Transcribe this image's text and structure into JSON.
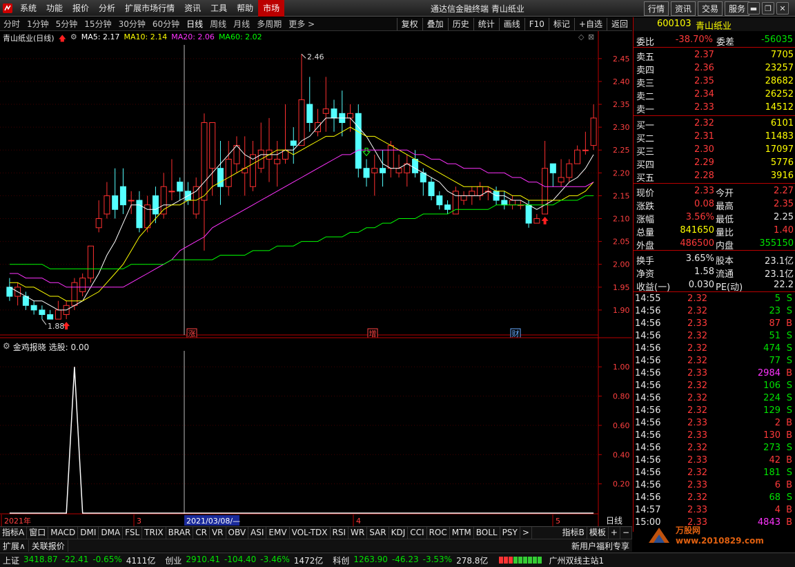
{
  "menubar": {
    "items": [
      "系统",
      "功能",
      "报价",
      "分析",
      "扩展市场行情",
      "资讯",
      "工具",
      "帮助"
    ],
    "active_item": "市场",
    "title": "通达信金融终端  青山纸业",
    "right_buttons": [
      "行情",
      "资讯",
      "交易",
      "服务"
    ]
  },
  "toolbar": {
    "periods": [
      "分时",
      "1分钟",
      "5分钟",
      "15分钟",
      "30分钟",
      "60分钟",
      "日线",
      "周线",
      "月线",
      "多周期",
      "更多 >"
    ],
    "active_period": "日线",
    "tools": [
      "复权",
      "叠加",
      "历史",
      "统计",
      "画线",
      "F10",
      "标记",
      "+自选",
      "返回"
    ]
  },
  "chart_legend": {
    "title": "青山纸业(日线)",
    "ma": [
      {
        "label": "MA5: 2.17",
        "color": "#ffffff"
      },
      {
        "label": "MA10: 2.14",
        "color": "#ffff00"
      },
      {
        "label": "MA20: 2.06",
        "color": "#ff33ff"
      },
      {
        "label": "MA60: 2.02",
        "color": "#00ff00"
      }
    ]
  },
  "chart_data": [
    {
      "type": "candlestick",
      "title": "青山纸业(日线)",
      "y_axis": {
        "min": 1.85,
        "max": 2.48,
        "ticks": [
          "2.45",
          "2.40",
          "2.35",
          "2.30",
          "2.25",
          "2.20",
          "2.15",
          "2.10",
          "2.05",
          "2.00",
          "1.95",
          "1.90"
        ]
      },
      "x_labels": [
        "2021年",
        "3",
        "4",
        "5"
      ],
      "cursor_date": "2021/03/08/—",
      "high_annotation": "2.46",
      "low_annotation": "1.88",
      "candles": [
        [
          1.95,
          1.93,
          1.97,
          1.92
        ],
        [
          1.93,
          1.95,
          1.96,
          1.91
        ],
        [
          1.93,
          1.91,
          1.94,
          1.9
        ],
        [
          1.91,
          1.9,
          1.92,
          1.89
        ],
        [
          1.9,
          1.89,
          1.91,
          1.88
        ],
        [
          1.89,
          1.88,
          1.9,
          1.88
        ],
        [
          1.88,
          1.9,
          1.92,
          1.88
        ],
        [
          1.89,
          1.91,
          1.92,
          1.88
        ],
        [
          1.91,
          1.96,
          1.97,
          1.9
        ],
        [
          1.94,
          1.97,
          1.98,
          1.93
        ],
        [
          1.97,
          2.04,
          2.04,
          1.96
        ],
        [
          2.08,
          2.1,
          2.14,
          2.07
        ],
        [
          2.11,
          2.15,
          2.18,
          2.1
        ],
        [
          2.15,
          2.12,
          2.21,
          2.1
        ],
        [
          2.17,
          2.13,
          2.21,
          2.11
        ],
        [
          2.14,
          2.14,
          2.16,
          2.11
        ],
        [
          2.14,
          2.08,
          2.16,
          2.07
        ],
        [
          2.08,
          2.13,
          2.15,
          2.07
        ],
        [
          2.15,
          2.11,
          2.17,
          2.09
        ],
        [
          2.11,
          2.17,
          2.2,
          2.1
        ],
        [
          2.16,
          2.16,
          2.23,
          2.14
        ],
        [
          2.18,
          2.16,
          2.19,
          2.14
        ],
        [
          2.16,
          2.14,
          2.18,
          2.13
        ],
        [
          2.11,
          2.17,
          2.19,
          2.1
        ],
        [
          2.14,
          2.31,
          2.33,
          2.03
        ],
        [
          2.21,
          2.31,
          2.31,
          2.15
        ],
        [
          2.21,
          2.17,
          2.27,
          2.13
        ],
        [
          2.17,
          2.23,
          2.27,
          2.15
        ],
        [
          2.22,
          2.26,
          2.28,
          2.2
        ],
        [
          2.2,
          2.21,
          2.28,
          2.15
        ],
        [
          2.17,
          2.24,
          2.27,
          2.16
        ],
        [
          2.21,
          2.25,
          2.31,
          2.2
        ],
        [
          2.23,
          2.25,
          2.32,
          2.18
        ],
        [
          2.22,
          2.23,
          2.27,
          2.17
        ],
        [
          2.23,
          2.25,
          2.35,
          2.22
        ],
        [
          2.27,
          2.26,
          2.3,
          2.22
        ],
        [
          2.26,
          2.36,
          2.46,
          2.26
        ],
        [
          2.35,
          2.31,
          2.41,
          2.29
        ],
        [
          2.29,
          2.31,
          2.34,
          2.28
        ],
        [
          2.33,
          2.34,
          2.41,
          2.29
        ],
        [
          2.34,
          2.32,
          2.36,
          2.29
        ],
        [
          2.33,
          2.31,
          2.38,
          2.28
        ],
        [
          2.32,
          2.33,
          2.35,
          2.29
        ],
        [
          2.33,
          2.21,
          2.35,
          2.19
        ],
        [
          2.21,
          2.19,
          2.23,
          2.17
        ],
        [
          2.2,
          2.21,
          2.24,
          2.15
        ],
        [
          2.21,
          2.2,
          2.25,
          2.17
        ],
        [
          2.21,
          2.26,
          2.27,
          2.19
        ],
        [
          2.2,
          2.21,
          2.24,
          2.19
        ],
        [
          2.2,
          2.22,
          2.24,
          2.17
        ],
        [
          2.23,
          2.2,
          2.25,
          2.19
        ],
        [
          2.2,
          2.18,
          2.21,
          2.15
        ],
        [
          2.18,
          2.15,
          2.19,
          2.14
        ],
        [
          2.15,
          2.13,
          2.16,
          2.12
        ],
        [
          2.13,
          2.12,
          2.14,
          2.11
        ],
        [
          2.11,
          2.16,
          2.17,
          2.11
        ],
        [
          2.14,
          2.15,
          2.16,
          2.13
        ],
        [
          2.15,
          2.16,
          2.17,
          2.13
        ],
        [
          2.15,
          2.17,
          2.18,
          2.14
        ],
        [
          2.16,
          2.16,
          2.17,
          2.14
        ],
        [
          2.16,
          2.14,
          2.17,
          2.13
        ],
        [
          2.14,
          2.13,
          2.16,
          2.12
        ],
        [
          2.13,
          2.14,
          2.15,
          2.12
        ],
        [
          2.13,
          2.13,
          2.14,
          2.12
        ],
        [
          2.13,
          2.09,
          2.14,
          2.08
        ],
        [
          2.09,
          2.1,
          2.11,
          2.09
        ],
        [
          2.11,
          2.21,
          2.27,
          2.11
        ],
        [
          2.22,
          2.2,
          2.22,
          2.17
        ],
        [
          2.18,
          2.19,
          2.23,
          2.17
        ],
        [
          2.19,
          2.22,
          2.23,
          2.18
        ],
        [
          2.22,
          2.25,
          2.26,
          2.22
        ],
        [
          2.25,
          2.25,
          2.29,
          2.24
        ],
        [
          2.26,
          2.32,
          2.35,
          2.25
        ]
      ],
      "series": [
        {
          "name": "MA5",
          "color": "#ffffff",
          "values": [
            1.95,
            1.94,
            1.93,
            1.92,
            1.92,
            1.91,
            1.9,
            1.9,
            1.91,
            1.92,
            1.95,
            1.98,
            2.02,
            2.05,
            2.09,
            2.13,
            2.13,
            2.12,
            2.12,
            2.13,
            2.13,
            2.14,
            2.15,
            2.16,
            2.18,
            2.2,
            2.22,
            2.24,
            2.26,
            2.24,
            2.23,
            2.24,
            2.24,
            2.24,
            2.25,
            2.25,
            2.27,
            2.28,
            2.3,
            2.32,
            2.32,
            2.32,
            2.32,
            2.3,
            2.28,
            2.25,
            2.22,
            2.21,
            2.21,
            2.22,
            2.21,
            2.2,
            2.19,
            2.18,
            2.16,
            2.15,
            2.15,
            2.15,
            2.15,
            2.16,
            2.15,
            2.15,
            2.14,
            2.14,
            2.13,
            2.12,
            2.13,
            2.14,
            2.16,
            2.18,
            2.19,
            2.21,
            2.24
          ]
        },
        {
          "name": "MA10",
          "color": "#ffff00",
          "values": [
            1.96,
            1.96,
            1.95,
            1.95,
            1.94,
            1.93,
            1.93,
            1.92,
            1.92,
            1.92,
            1.93,
            1.94,
            1.96,
            1.98,
            2.0,
            2.03,
            2.06,
            2.08,
            2.1,
            2.12,
            2.13,
            2.13,
            2.14,
            2.14,
            2.15,
            2.17,
            2.18,
            2.19,
            2.2,
            2.21,
            2.22,
            2.23,
            2.24,
            2.25,
            2.25,
            2.24,
            2.25,
            2.26,
            2.27,
            2.28,
            2.28,
            2.29,
            2.3,
            2.29,
            2.28,
            2.28,
            2.27,
            2.26,
            2.25,
            2.24,
            2.23,
            2.22,
            2.21,
            2.2,
            2.19,
            2.18,
            2.17,
            2.17,
            2.17,
            2.17,
            2.16,
            2.16,
            2.15,
            2.15,
            2.14,
            2.14,
            2.14,
            2.14,
            2.14,
            2.15,
            2.15,
            2.16,
            2.18
          ]
        },
        {
          "name": "MA20",
          "color": "#ff33ff",
          "values": [
            1.98,
            1.98,
            1.97,
            1.97,
            1.97,
            1.96,
            1.96,
            1.95,
            1.95,
            1.95,
            1.95,
            1.95,
            1.95,
            1.95,
            1.95,
            1.96,
            1.97,
            1.98,
            1.99,
            2.0,
            2.01,
            2.03,
            2.04,
            2.05,
            2.06,
            2.08,
            2.09,
            2.1,
            2.11,
            2.12,
            2.13,
            2.14,
            2.15,
            2.16,
            2.17,
            2.18,
            2.19,
            2.2,
            2.21,
            2.22,
            2.23,
            2.24,
            2.24,
            2.25,
            2.25,
            2.25,
            2.25,
            2.25,
            2.25,
            2.25,
            2.24,
            2.24,
            2.23,
            2.23,
            2.22,
            2.22,
            2.21,
            2.21,
            2.21,
            2.2,
            2.2,
            2.2,
            2.19,
            2.19,
            2.18,
            2.18,
            2.17,
            2.17,
            2.17,
            2.17,
            2.17,
            2.17,
            2.18
          ]
        },
        {
          "name": "MA60",
          "color": "#00ff00",
          "values": [
            2.0,
            2.0,
            2.0,
            2.0,
            2.0,
            1.99,
            1.99,
            1.99,
            1.99,
            1.99,
            1.99,
            1.99,
            1.99,
            1.99,
            1.99,
            2.0,
            2.0,
            2.0,
            2.0,
            2.0,
            2.01,
            2.01,
            2.01,
            2.01,
            2.01,
            2.01,
            2.02,
            2.02,
            2.02,
            2.02,
            2.03,
            2.03,
            2.03,
            2.04,
            2.04,
            2.04,
            2.05,
            2.05,
            2.05,
            2.06,
            2.06,
            2.06,
            2.07,
            2.07,
            2.08,
            2.08,
            2.09,
            2.09,
            2.1,
            2.1,
            2.1,
            2.11,
            2.11,
            2.11,
            2.11,
            2.12,
            2.12,
            2.12,
            2.12,
            2.12,
            2.13,
            2.13,
            2.13,
            2.13,
            2.13,
            2.13,
            2.13,
            2.13,
            2.14,
            2.14,
            2.14,
            2.15,
            2.15
          ]
        }
      ],
      "markers": [
        {
          "label": "涨",
          "color": "#ff4444"
        },
        {
          "label": "增",
          "color": "#ff4444"
        },
        {
          "label": "财",
          "color": "#66aaff"
        }
      ]
    },
    {
      "type": "line",
      "title": "金鸡报晓 选股: 0.00",
      "y_axis": {
        "min": 0,
        "max": 1.1,
        "ticks": [
          "1.00",
          "0.80",
          "0.60",
          "0.40",
          "0.20"
        ]
      },
      "series": [
        {
          "name": "选股",
          "color": "#ffffff",
          "values": [
            0,
            0,
            0,
            0,
            0,
            0,
            0,
            0,
            1,
            0,
            0,
            0,
            0,
            0,
            0,
            0,
            0,
            0,
            0,
            0,
            0,
            0,
            0,
            0,
            0,
            0,
            0,
            0,
            0,
            0,
            0,
            0,
            0,
            0,
            0,
            0,
            0,
            0,
            0,
            0,
            0,
            0,
            0,
            0,
            0,
            0,
            0,
            0,
            0,
            0,
            0,
            0,
            0,
            0,
            0,
            0,
            0,
            0,
            0,
            0,
            0,
            0,
            0,
            0,
            0,
            0,
            0,
            0,
            0,
            0,
            0,
            0,
            0
          ]
        }
      ]
    }
  ],
  "quote": {
    "code": "600103",
    "name": "青山纸业",
    "weibi": {
      "label1": "委比",
      "v1": "-38.70%",
      "label2": "委差",
      "v2": "-56035"
    },
    "asks": [
      {
        "label": "卖五",
        "price": "2.37",
        "vol": "7705"
      },
      {
        "label": "卖四",
        "price": "2.36",
        "vol": "23257"
      },
      {
        "label": "卖三",
        "price": "2.35",
        "vol": "28682"
      },
      {
        "label": "卖二",
        "price": "2.34",
        "vol": "26252"
      },
      {
        "label": "卖一",
        "price": "2.33",
        "vol": "14512"
      }
    ],
    "bids": [
      {
        "label": "买一",
        "price": "2.32",
        "vol": "6101"
      },
      {
        "label": "买二",
        "price": "2.31",
        "vol": "11483"
      },
      {
        "label": "买三",
        "price": "2.30",
        "vol": "17097"
      },
      {
        "label": "买四",
        "price": "2.29",
        "vol": "5776"
      },
      {
        "label": "买五",
        "price": "2.28",
        "vol": "3916"
      }
    ],
    "stats": [
      {
        "l1": "现价",
        "v1": "2.33",
        "c1": "red",
        "l2": "今开",
        "v2": "2.27",
        "c2": "red"
      },
      {
        "l1": "涨跌",
        "v1": "0.08",
        "c1": "red",
        "l2": "最高",
        "v2": "2.35",
        "c2": "red"
      },
      {
        "l1": "涨幅",
        "v1": "3.56%",
        "c1": "red",
        "l2": "最低",
        "v2": "2.25",
        "c2": "wht"
      },
      {
        "l1": "总量",
        "v1": "841650",
        "c1": "yel",
        "l2": "量比",
        "v2": "1.40",
        "c2": "red"
      },
      {
        "l1": "外盘",
        "v1": "486500",
        "c1": "red",
        "l2": "内盘",
        "v2": "355150",
        "c2": "grn"
      },
      {
        "l1": "换手",
        "v1": "3.65%",
        "c1": "wht",
        "l2": "股本",
        "v2": "23.1亿",
        "c2": "wht"
      },
      {
        "l1": "净资",
        "v1": "1.58",
        "c1": "wht",
        "l2": "流通",
        "v2": "23.1亿",
        "c2": "wht"
      },
      {
        "l1": "收益(一)",
        "v1": "0.030",
        "c1": "wht",
        "l2": "PE(动)",
        "v2": "22.2",
        "c2": "wht"
      }
    ],
    "ticks": [
      [
        "14:55",
        "2.32",
        "5",
        "S"
      ],
      [
        "14:56",
        "2.32",
        "23",
        "S"
      ],
      [
        "14:56",
        "2.33",
        "87",
        "B"
      ],
      [
        "14:56",
        "2.32",
        "51",
        "S"
      ],
      [
        "14:56",
        "2.32",
        "474",
        "S"
      ],
      [
        "14:56",
        "2.32",
        "77",
        "S"
      ],
      [
        "14:56",
        "2.33",
        "2984",
        "B"
      ],
      [
        "14:56",
        "2.32",
        "106",
        "S"
      ],
      [
        "14:56",
        "2.32",
        "224",
        "S"
      ],
      [
        "14:56",
        "2.32",
        "129",
        "S"
      ],
      [
        "14:56",
        "2.33",
        "2",
        "B"
      ],
      [
        "14:56",
        "2.33",
        "130",
        "B"
      ],
      [
        "14:56",
        "2.32",
        "273",
        "S"
      ],
      [
        "14:56",
        "2.33",
        "42",
        "B"
      ],
      [
        "14:56",
        "2.32",
        "181",
        "S"
      ],
      [
        "14:56",
        "2.33",
        "6",
        "B"
      ],
      [
        "14:56",
        "2.32",
        "68",
        "S"
      ],
      [
        "14:57",
        "2.33",
        "4",
        "B"
      ],
      [
        "15:00",
        "2.33",
        "4843",
        "B"
      ]
    ]
  },
  "bottom_tabs": {
    "left": [
      "指标A",
      "窗口"
    ],
    "indicators": [
      "MACD",
      "DMI",
      "DMA",
      "FSL",
      "TRIX",
      "BRAR",
      "CR",
      "VR",
      "OBV",
      "ASI",
      "EMV",
      "VOL-TDX",
      "RSI",
      "WR",
      "SAR",
      "KDJ",
      "CCI",
      "ROC",
      "MTM",
      "BOLL",
      "PSY"
    ],
    "more": ">",
    "right": [
      "指标B",
      "模板",
      "+",
      "−"
    ],
    "axis_mode": "日线"
  },
  "bottom2": {
    "left": [
      "扩展∧",
      "关联报价"
    ],
    "right": "新用户福利专享"
  },
  "statusbar": [
    {
      "name": "上证",
      "value": "3418.87",
      "change": "-22.41",
      "pct": "-0.65%",
      "amt": "4111亿"
    },
    {
      "name": "创业",
      "value": "2910.41",
      "change": "-104.40",
      "pct": "-3.46%",
      "amt": "1472亿"
    },
    {
      "name": "科创",
      "value": "1263.90",
      "change": "-46.23",
      "pct": "-3.53%",
      "amt": "278.8亿"
    }
  ],
  "status_server": "广州双线主站1",
  "watermark": "万股网 www.2010829.com"
}
